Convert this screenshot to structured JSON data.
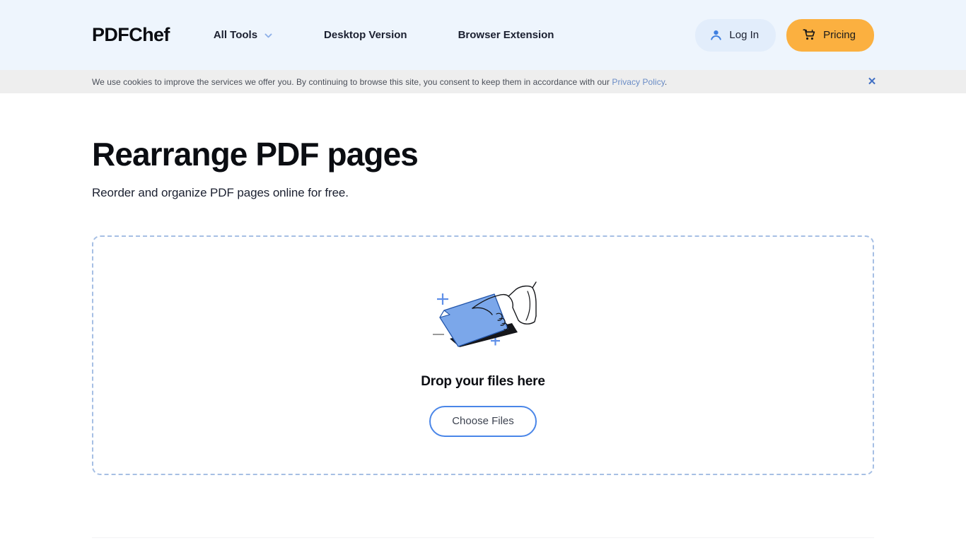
{
  "header": {
    "logo": "PDFChef",
    "nav": [
      {
        "label": "All Tools",
        "has_chevron": true,
        "icon": "chevron-down-icon"
      },
      {
        "label": "Desktop Version",
        "has_chevron": false
      },
      {
        "label": "Browser Extension",
        "has_chevron": false
      }
    ],
    "login_label": "Log In",
    "login_icon": "person-icon",
    "pricing_label": "Pricing",
    "pricing_icon": "cart-icon",
    "background_color": "#eef5fd",
    "pricing_color": "#fbb040",
    "login_bg_color": "#e2edfb"
  },
  "cookie": {
    "text_before": "We use cookies to improve the services we offer you. By continuing to browse this site, you consent to keep them in accordance with our ",
    "link_label": "Privacy Policy",
    "text_after": ".",
    "close_icon": "close-icon",
    "close_glyph": "✕",
    "background_color": "#eeeeee",
    "link_color": "#6a8cc6"
  },
  "main": {
    "title": "Rearrange PDF pages",
    "subtitle": "Reorder and organize PDF pages online for free."
  },
  "dropzone": {
    "illustration_name": "hand-dragging-document-illustration",
    "title": "Drop your files here",
    "button_label": "Choose Files",
    "border_color": "#a6bfe4",
    "button_border_color": "#4a86e8",
    "card_color": "#7ba7ea"
  }
}
